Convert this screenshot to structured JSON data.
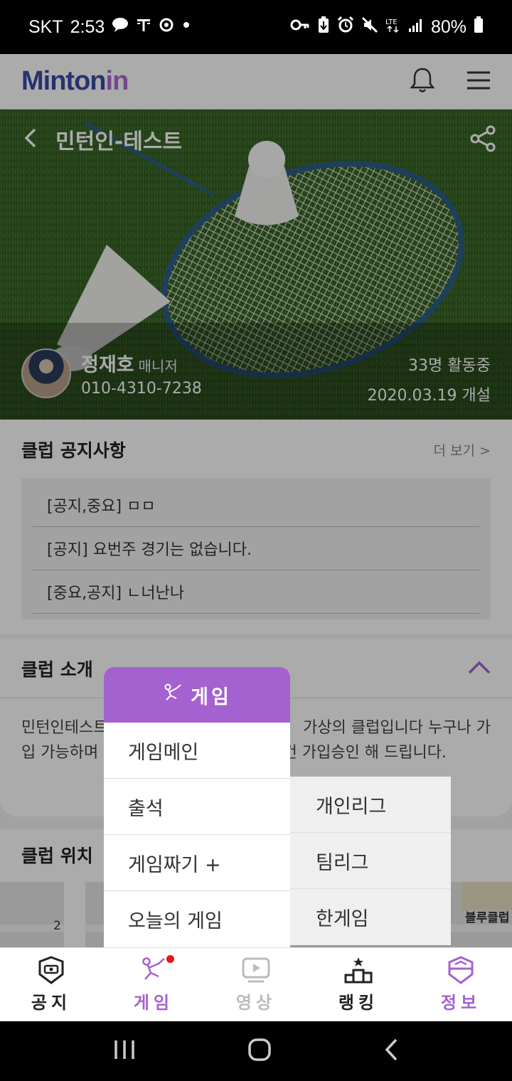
{
  "status_bar": {
    "carrier": "SKT",
    "time": "2:53",
    "battery": "80%",
    "icons": [
      "talk-icon",
      "t-icon",
      "location-icon",
      "dot-icon",
      "key-icon",
      "battery-saver-icon",
      "alarm-icon",
      "mute-icon",
      "lte-icon",
      "signal-icon",
      "battery-icon"
    ]
  },
  "header": {
    "logo_main": "Minton",
    "logo_in": "in",
    "icons": [
      "bell-icon",
      "menu-icon"
    ]
  },
  "hero": {
    "club_title": "민턴인-테스트",
    "manager_name": "정재호",
    "manager_role": "매니저",
    "manager_phone": "010-4310-7238",
    "members_active": "33명 활동중",
    "founded": "2020.03.19 개설"
  },
  "notice": {
    "title": "클럽 공지사항",
    "more": "더 보기 >",
    "items": [
      "[공지,중요] ㅁㅁ",
      "[공지] 요번주 경기는 없습니다.",
      "[중요,공지] ㄴ너난나"
    ]
  },
  "intro": {
    "title": "클럽 소개",
    "line1_left": "민턴인테스트",
    "line1_right": "가상의 클럽입니다 누구나 가",
    "line2_left": "입 가능하며",
    "line2_right": "건 가입승인 해 드립니다."
  },
  "location": {
    "title": "클럽 위치",
    "map_labels": [
      "2",
      "블루클럽"
    ]
  },
  "game_menu": {
    "header": "게임",
    "items": [
      "게임메인",
      "출석",
      "게임짜기 +",
      "오늘의 게임"
    ],
    "sub_items": [
      "개인리그",
      "팀리그",
      "한게임"
    ]
  },
  "tabbar": {
    "tabs": [
      {
        "label": "공지",
        "color": "#222222"
      },
      {
        "label": "게임",
        "color": "#a462d0"
      },
      {
        "label": "영상",
        "color": "#bbbbbb"
      },
      {
        "label": "랭킹",
        "color": "#222222"
      },
      {
        "label": "정보",
        "color": "#a462d0"
      }
    ]
  },
  "colors": {
    "accent": "#a462d0",
    "brand_blue": "#3c4ba8",
    "notify_dot": "#e11111"
  }
}
